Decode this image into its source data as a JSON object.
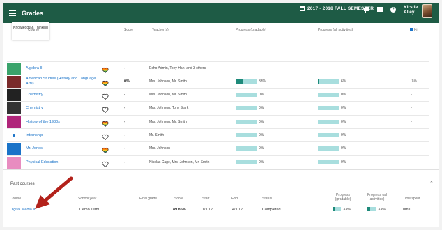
{
  "header": {
    "title": "Grades",
    "term": "2017 - 2018 FALL SEMESTER",
    "user_name": "Kirstie Alley"
  },
  "tile": {
    "label": "Knowledge & Thinking"
  },
  "columns": {
    "course": "Course",
    "score": "Score",
    "teachers": "Teacher(s)",
    "progress_gradable": "Progress (gradable)",
    "progress_all": "Progress (all activities)",
    "legend": "Ki"
  },
  "courses": [
    {
      "name": "Algebra II",
      "score": "-",
      "teachers": "Echo Admin, Tony Han, and 3 others",
      "gradable": null,
      "gradable_label": "",
      "all": null,
      "all_label": "",
      "extra": "-",
      "heart": "rainbow",
      "thumb": "#3aa36b"
    },
    {
      "name": "American Studies (History and Language Arts)",
      "score": "0%",
      "teachers": "Mrs. Johnson, Mr. Smith",
      "gradable": 0.33,
      "gradable_label": "33%",
      "all": 0.06,
      "all_label": "6%",
      "extra": "0%",
      "heart": "rainbow",
      "thumb": "#7a2b2b"
    },
    {
      "name": "Chemistry",
      "score": "-",
      "teachers": "Mrs. Johnson, Mr. Smith",
      "gradable": 0,
      "gradable_label": "0%",
      "all": 0,
      "all_label": "0%",
      "extra": "-",
      "heart": "outline",
      "thumb": "#222222"
    },
    {
      "name": "Chemistry",
      "score": "-",
      "teachers": "Mrs. Johnson, Tony Stark",
      "gradable": 0,
      "gradable_label": "0%",
      "all": 0,
      "all_label": "0%",
      "extra": "-",
      "heart": "outline",
      "thumb": "#333333"
    },
    {
      "name": "History of the 1980s",
      "score": "-",
      "teachers": "Mrs. Johnson, Mr. Smith",
      "gradable": 0,
      "gradable_label": "0%",
      "all": 0,
      "all_label": "0%",
      "extra": "-",
      "heart": "rainbow",
      "thumb": "#b0257a"
    },
    {
      "name": "Internship",
      "score": "-",
      "teachers": "Mr. Smith",
      "gradable": 0,
      "gradable_label": "0%",
      "all": 0,
      "all_label": "0%",
      "extra": "-",
      "heart": "outline",
      "thumb": "dot"
    },
    {
      "name": "Mr. Jones",
      "score": "-",
      "teachers": "Mrs. Johnson",
      "gradable": 0,
      "gradable_label": "0%",
      "all": 0,
      "all_label": "0%",
      "extra": "-",
      "heart": "rainbow",
      "thumb": "#1a73c8"
    },
    {
      "name": "Physical Education",
      "score": "-",
      "teachers": "Nicolas Cage, Mrs. Johnson, Mr. Smith",
      "gradable": 0,
      "gradable_label": "0%",
      "all": 0,
      "all_label": "0%",
      "extra": "-",
      "heart": "outline",
      "thumb": "#e88cc0"
    }
  ],
  "past": {
    "title": "Past courses",
    "headers": {
      "course": "Course",
      "school_year": "School year",
      "final_grade": "Final grade",
      "score": "Score",
      "start": "Start",
      "end": "End",
      "status": "Status",
      "progress_gradable": "Progress (gradable)",
      "progress_all": "Progress (all activities)",
      "time_spent": "Time spent"
    },
    "row": {
      "course": "Digital Media II",
      "school_year": "Demo Term",
      "final_grade": "",
      "score": "89.85%",
      "start": "1/1/17",
      "end": "4/1/17",
      "status": "Completed",
      "gradable": 0.33,
      "gradable_label": "33%",
      "all": 0.33,
      "all_label": "33%",
      "time_spent": "0ms"
    }
  },
  "colors": {
    "header_bg": "#1e5b45",
    "link": "#1a73c8",
    "bar_track": "#a8dede",
    "bar_fill": "#1e8a7a",
    "arrow": "#b3221b"
  }
}
